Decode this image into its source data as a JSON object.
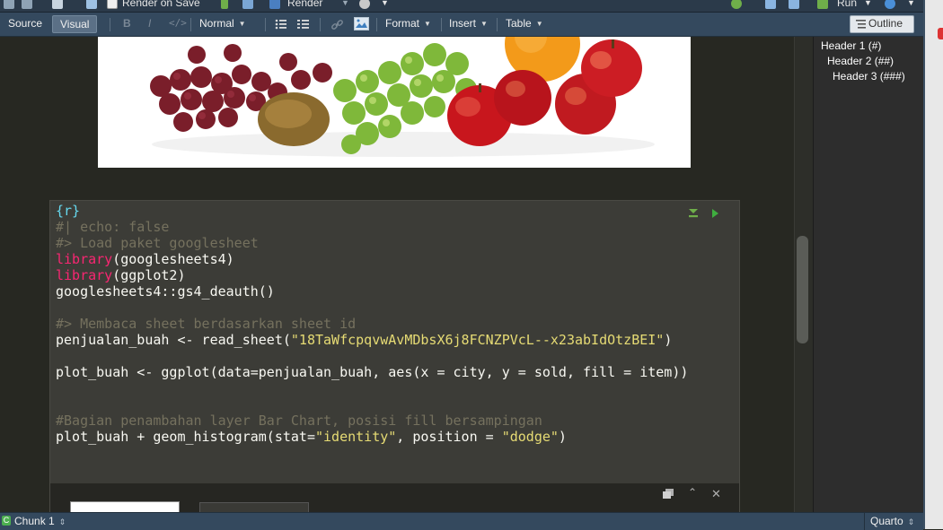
{
  "toolbar": {
    "render_on_save": "Render on Save",
    "render": "Render",
    "run": "Run"
  },
  "visual_toolbar": {
    "source_tab": "Source",
    "visual_tab": "Visual",
    "bold": "B",
    "italic": "I",
    "code": "</>",
    "paragraph_style": "Normal",
    "format_menu": "Format",
    "insert_menu": "Insert",
    "table_menu": "Table",
    "outline_button": "Outline"
  },
  "outline": {
    "items": [
      "Header 1 (#)",
      "Header 2 (##)",
      "Header 3 (###)"
    ]
  },
  "code_chunk": {
    "header": "{r}",
    "lines": [
      "#| echo: false",
      "#> Load paket googlesheet",
      "library",
      "(googlesheets4)",
      "library",
      "(ggplot2)",
      "googlesheets4::gs4_deauth()",
      "#> Membaca sheet berdasarkan sheet id",
      "penjualan_buah <- read_sheet(",
      "\"18TaWfcpqvwAvMDbsX6j8FCNZPVcL--x23abIdOtzBEI\"",
      ")",
      "plot_buah <- ggplot(data=penjualan_buah, aes(x = city, y = sold, fill = item))",
      "#Bagian penambahan layer Bar Chart, posisi fill bersampingan",
      "plot_buah + geom_histogram(stat=",
      "\"identity\"",
      ", position = ",
      "\"dodge\"",
      ")"
    ]
  },
  "status": {
    "chunk_label": "Chunk 1",
    "doc_type": "Quarto"
  },
  "colors": {
    "editor_bg": "#272822",
    "chunk_bg": "#3c3c37",
    "toolbar_bg": "#34495e",
    "comment": "#75715e",
    "keyword": "#f92672",
    "string": "#e6db74",
    "chunk_header": "#66d9ef"
  }
}
